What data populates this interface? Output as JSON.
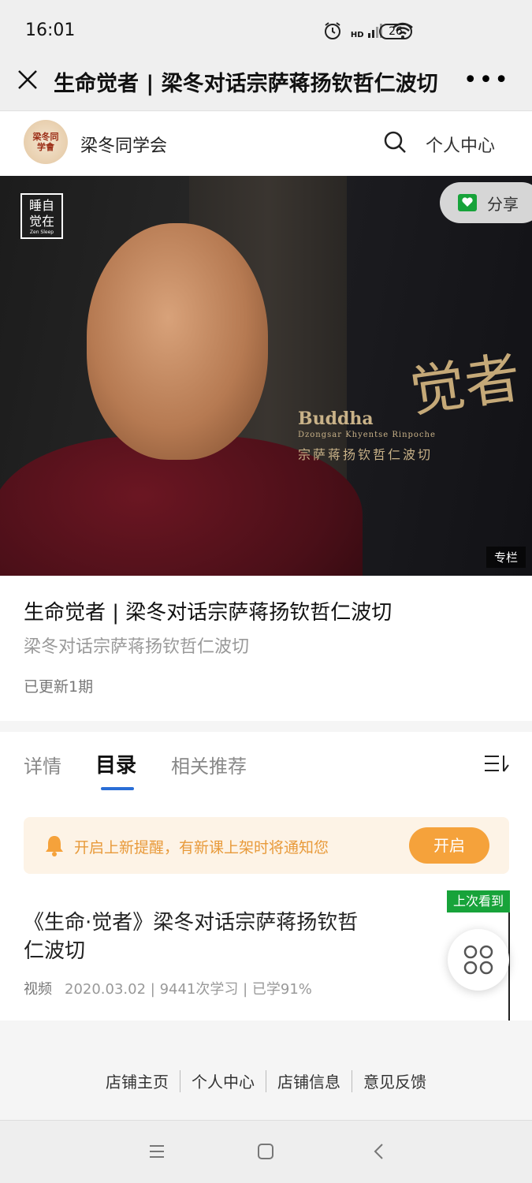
{
  "status_bar": {
    "time": "16:01",
    "battery": "26",
    "network": "HD"
  },
  "title_bar": {
    "title": "生命觉者 | 梁冬对话宗萨蒋扬钦哲仁波切"
  },
  "store": {
    "logo_text": "梁冬同学會",
    "name": "梁冬同学会",
    "personal_center": "个人中心"
  },
  "hero": {
    "badge_text": "睡自觉在",
    "badge_sub": "Zen Sleep",
    "title_en": "Buddha",
    "title_sub": "Dzongsar Khyentse Rinpoche",
    "title_cn": "宗萨蒋扬钦哲仁波切",
    "big_text": "觉者",
    "share_label": "分享",
    "tag": "专栏"
  },
  "course": {
    "title": "生命觉者 | 梁冬对话宗萨蒋扬钦哲仁波切",
    "subtitle": "梁冬对话宗萨蒋扬钦哲仁波切",
    "updated": "已更新1期"
  },
  "tabs": [
    {
      "label": "详情"
    },
    {
      "label": "目录"
    },
    {
      "label": "相关推荐"
    }
  ],
  "notice": {
    "text": "开启上新提醒，有新课上架时将通知您",
    "button": "开启"
  },
  "lesson": {
    "last_seen": "上次看到",
    "title": "《生命·觉者》梁冬对话宗萨蒋扬钦哲仁波切",
    "type": "视频",
    "meta": "2020.03.02 | 9441次学习 | 已学91%"
  },
  "footer": {
    "links": [
      "店铺主页",
      "个人中心",
      "店铺信息",
      "意见反馈"
    ]
  },
  "colors": {
    "accent_blue": "#2a6ed6",
    "orange": "#f5a23b",
    "green": "#17a33a"
  }
}
